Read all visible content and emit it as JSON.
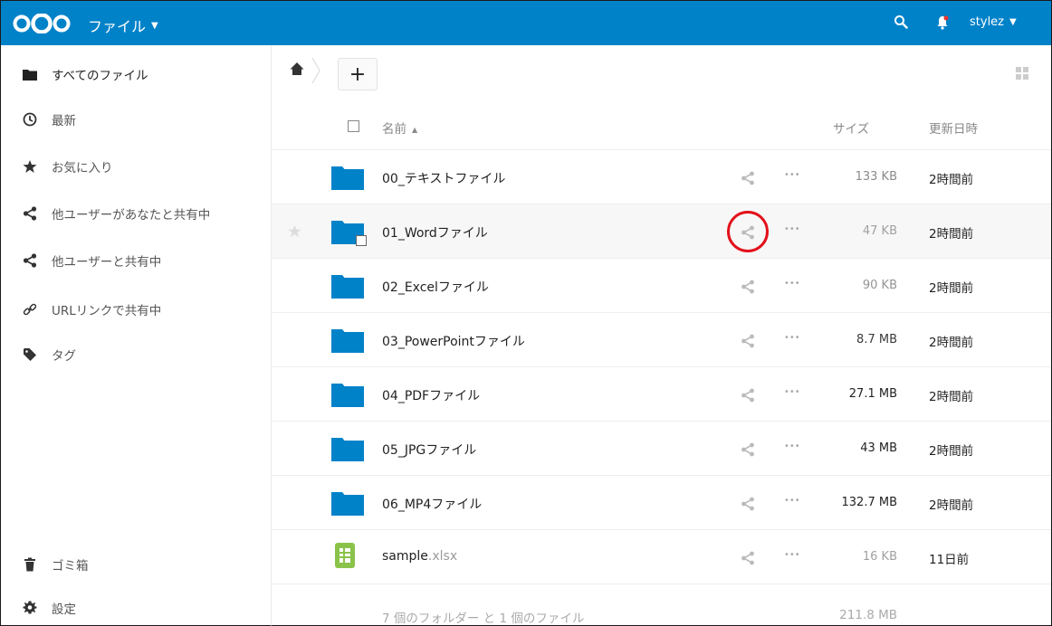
{
  "header": {
    "app_name": "ファイル",
    "user_name": "stylez"
  },
  "sidebar": {
    "items": [
      {
        "label": "すべてのファイル",
        "icon": "folder-icon"
      },
      {
        "label": "最新",
        "icon": "clock-icon"
      },
      {
        "label": "お気に入り",
        "icon": "star-icon"
      },
      {
        "label": "他ユーザーがあなたと共有中",
        "icon": "share-icon"
      },
      {
        "label": "他ユーザーと共有中",
        "icon": "share-icon"
      },
      {
        "label": "URLリンクで共有中",
        "icon": "link-icon"
      },
      {
        "label": "タグ",
        "icon": "tag-icon"
      }
    ],
    "bottom": [
      {
        "label": "ゴミ箱",
        "icon": "trash-icon"
      },
      {
        "label": "設定",
        "icon": "gear-icon"
      }
    ]
  },
  "toolbar": {
    "new_label": "+"
  },
  "table": {
    "columns": {
      "name": "名前",
      "size": "サイズ",
      "modified": "更新日時"
    },
    "rows": [
      {
        "name": "00_テキストファイル",
        "ext": "",
        "type": "folder",
        "size": "133 KB",
        "modified": "2時間前",
        "size_color": "#8a8a8a"
      },
      {
        "name": "01_Wordファイル",
        "ext": "",
        "type": "folder",
        "size": "47 KB",
        "modified": "2時間前",
        "size_color": "#a0a0a0"
      },
      {
        "name": "02_Excelファイル",
        "ext": "",
        "type": "folder",
        "size": "90 KB",
        "modified": "2時間前",
        "size_color": "#939393"
      },
      {
        "name": "03_PowerPointファイル",
        "ext": "",
        "type": "folder",
        "size": "8.7 MB",
        "modified": "2時間前",
        "size_color": "#3a3a3a"
      },
      {
        "name": "04_PDFファイル",
        "ext": "",
        "type": "folder",
        "size": "27.1 MB",
        "modified": "2時間前",
        "size_color": "#222222"
      },
      {
        "name": "05_JPGファイル",
        "ext": "",
        "type": "folder",
        "size": "43 MB",
        "modified": "2時間前",
        "size_color": "#222222"
      },
      {
        "name": "06_MP4ファイル",
        "ext": "",
        "type": "folder",
        "size": "132.7 MB",
        "modified": "2時間前",
        "size_color": "#222222"
      },
      {
        "name": "sample",
        "ext": ".xlsx",
        "type": "spreadsheet",
        "size": "16 KB",
        "modified": "11日前",
        "size_color": "#a0a0a0"
      }
    ],
    "summary": {
      "count": "7 個のフォルダー と 1 個のファイル",
      "total": "211.8 MB"
    }
  },
  "colors": {
    "header_bg": "#0082c9",
    "folder": "#0082c9",
    "spreadsheet": "#8bc34a",
    "highlight": "#e3101a"
  }
}
